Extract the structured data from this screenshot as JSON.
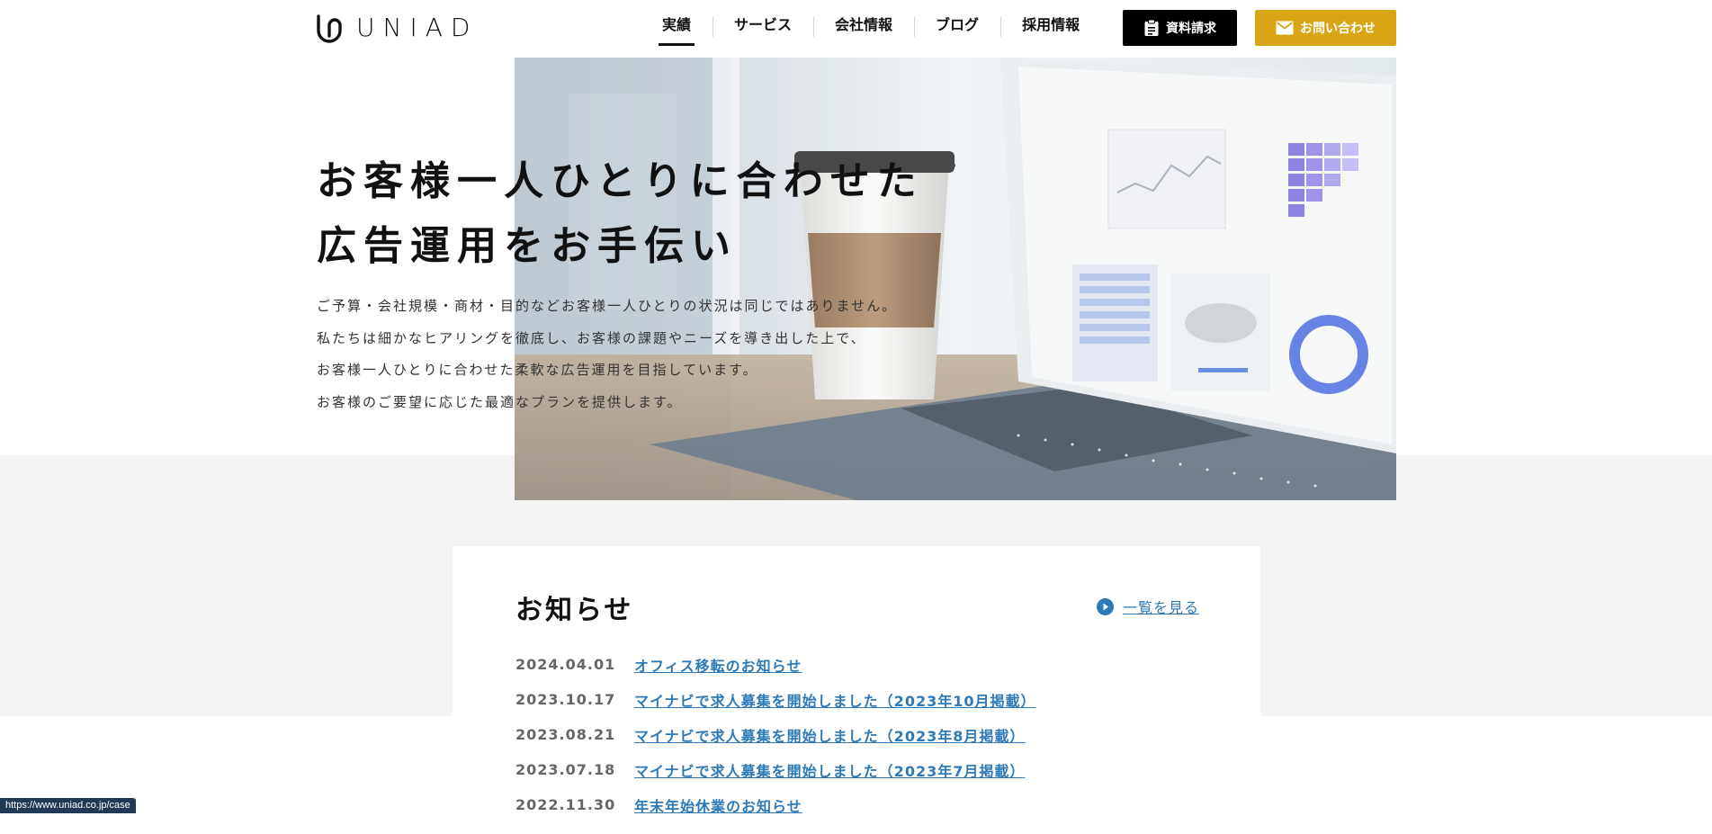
{
  "header": {
    "logo_text": "UNIAD",
    "nav": [
      {
        "label": "実績",
        "active": true
      },
      {
        "label": "サービス"
      },
      {
        "label": "会社情報"
      },
      {
        "label": "ブログ"
      },
      {
        "label": "採用情報"
      }
    ],
    "document_button": "資料請求",
    "contact_button": "お問い合わせ",
    "contact_color": "#d9a515"
  },
  "hero": {
    "title_line1": "お客様一人ひとりに合わせた",
    "title_line2": "広告運用をお手伝い",
    "lead": [
      "ご予算・会社規模・商材・目的などお客様一人ひとりの状況は同じではありません。",
      "私たちは細かなヒアリングを徹底し、お客様の課題やニーズを導き出した上で、",
      "お客様一人ひとりに合わせた柔軟な広告運用を目指しています。",
      "お客様のご要望に応じた最適なプランを提供します。"
    ]
  },
  "news": {
    "title": "お知らせ",
    "more_label": "一覧を見る",
    "link_color": "#2e7ab8",
    "items": [
      {
        "date": "2024.04.01",
        "title": "オフィス移転のお知らせ"
      },
      {
        "date": "2023.10.17",
        "title": "マイナビで求人募集を開始しました（2023年10月掲載）"
      },
      {
        "date": "2023.08.21",
        "title": "マイナビで求人募集を開始しました（2023年8月掲載）"
      },
      {
        "date": "2023.07.18",
        "title": "マイナビで求人募集を開始しました（2023年7月掲載）"
      },
      {
        "date": "2022.11.30",
        "title": "年末年始休業のお知らせ"
      }
    ]
  },
  "statusbar": {
    "url": "https://www.uniad.co.jp/case"
  }
}
